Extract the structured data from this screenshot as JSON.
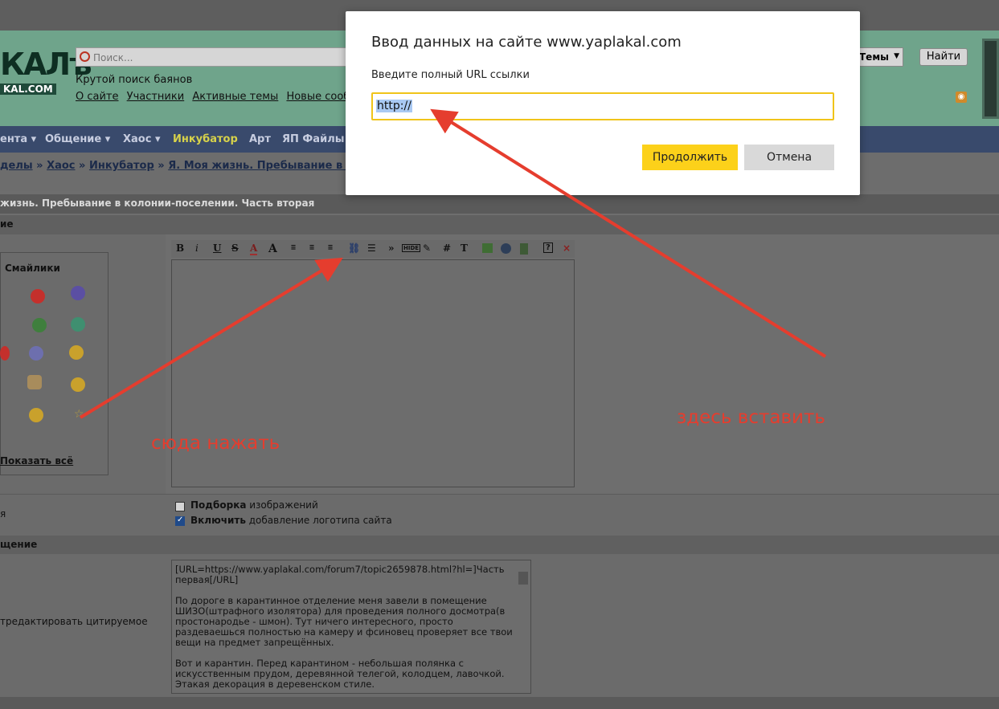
{
  "header": {
    "logo_big": "КАЛъ",
    "logo_small": "KAL.COM",
    "search_placeholder": "Поиск...",
    "slogan": "Крутой поиск баянов",
    "nav": [
      "О сайте",
      "Участники",
      "Активные темы",
      "Новые сообще"
    ],
    "topics_select": "Темы",
    "find_button": "Найти"
  },
  "menu": {
    "items": [
      "ента ▾",
      "Общение ▾",
      "Хаос ▾",
      "Инкубатор",
      "Арт",
      "ЯП Файлы"
    ]
  },
  "breadcrumb": {
    "items": [
      "делы",
      "Хаос",
      "Инкубатор",
      "Я. Моя жизнь. Пребывание в коло"
    ],
    "separator": "»"
  },
  "topic_title": "жизнь. Пребывание в колонии-поселении. Часть вторая",
  "sections": {
    "message_head": "ие",
    "smileys_title": "Смайлики",
    "show_all": "Показать всё",
    "options_label": "я",
    "quote_head": "щение",
    "quote_label": "тредактировать цитируемое"
  },
  "toolbar": {
    "bold": "B",
    "italic": "i",
    "underline": "U",
    "strike": "S",
    "color": "A",
    "size": "A",
    "more": "»",
    "hide": "HIDE",
    "hash": "#",
    "text": "T",
    "help": "?",
    "close": "×"
  },
  "options": {
    "picks_bold": "Подборка",
    "picks_rest": " изображений",
    "picks_checked": false,
    "logo_bold": "Включить",
    "logo_rest": " добавление логотипа сайта",
    "logo_checked": true
  },
  "quote_text": "[URL=https://www.yaplakal.com/forum7/topic2659878.html?hl=]Часть первая[/URL]\n\nПо дороге в карантинное отделение меня завели в помещение ШИЗО(штрафного изолятора) для проведения полного досмотра(в простонародье - шмон). Тут ничего интересного, просто раздеваешься полностью на камеру и фсиновец проверяет все твои вещи на предмет запрещённых.\n\nВот и карантин. Перед карантином - небольшая полянка с искусственным прудом, деревянной телегой, колодцем, лавочкой. Этакая декорация в деревенском стиле.",
  "dialog": {
    "title": "Ввод данных на сайте www.yaplakal.com",
    "prompt": "Введите полный URL ссылки",
    "url_value": "http://",
    "continue": "Продолжить",
    "cancel": "Отмена"
  },
  "annotations": {
    "click_here": "сюда нажать",
    "paste_here": "здесь вставить",
    "color": "#e53d2e"
  }
}
